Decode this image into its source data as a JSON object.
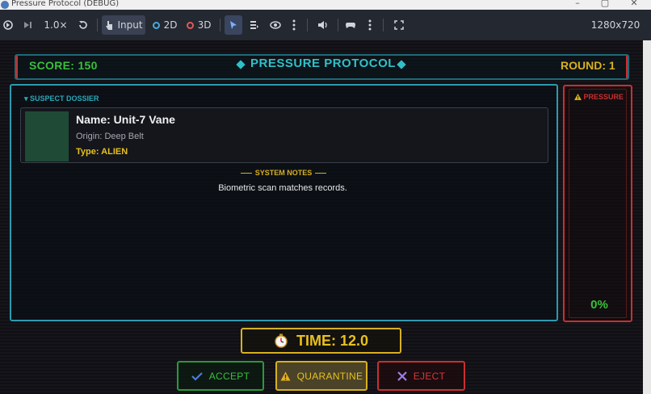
{
  "window": {
    "title": "Pressure Protocol (DEBUG)"
  },
  "toolbar": {
    "speed": "1.0×",
    "input_label": "Input",
    "mode_2d": "2D",
    "mode_3d": "3D",
    "resolution": "1280x720"
  },
  "hud": {
    "score": "SCORE: 150",
    "title": "PRESSURE PROTOCOL",
    "round": "ROUND: 1"
  },
  "dossier": {
    "label": "▾ SUSPECT DOSSIER",
    "name": "Name: Unit-7 Vane",
    "origin": "Origin: Deep Belt",
    "type": "Type: ALIEN"
  },
  "notes": {
    "label": "SYSTEM NOTES",
    "text": "Biometric scan matches records."
  },
  "pressure": {
    "label": "PRESSURE",
    "value_text": "0%",
    "value": 0
  },
  "timer": {
    "text": "TIME: 12.0"
  },
  "actions": {
    "accept": "ACCEPT",
    "quarantine": "QUARANTINE",
    "eject": "EJECT"
  },
  "colors": {
    "accent_cyan": "#30c0c8",
    "accept_green": "#38c03a",
    "quarantine_yellow": "#e8c020",
    "eject_red": "#d83838",
    "pressure_red": "#c83030"
  },
  "icons": [
    "app-icon",
    "minimize-icon",
    "maximize-icon",
    "close-icon",
    "rewind-icon",
    "step-icon",
    "reset-icon",
    "pointer-icon",
    "list-icon",
    "eye-icon",
    "more-icon",
    "speaker-icon",
    "gamepad-icon",
    "fullscreen-icon",
    "warning-icon",
    "stopwatch-icon",
    "check-icon",
    "x-icon"
  ]
}
